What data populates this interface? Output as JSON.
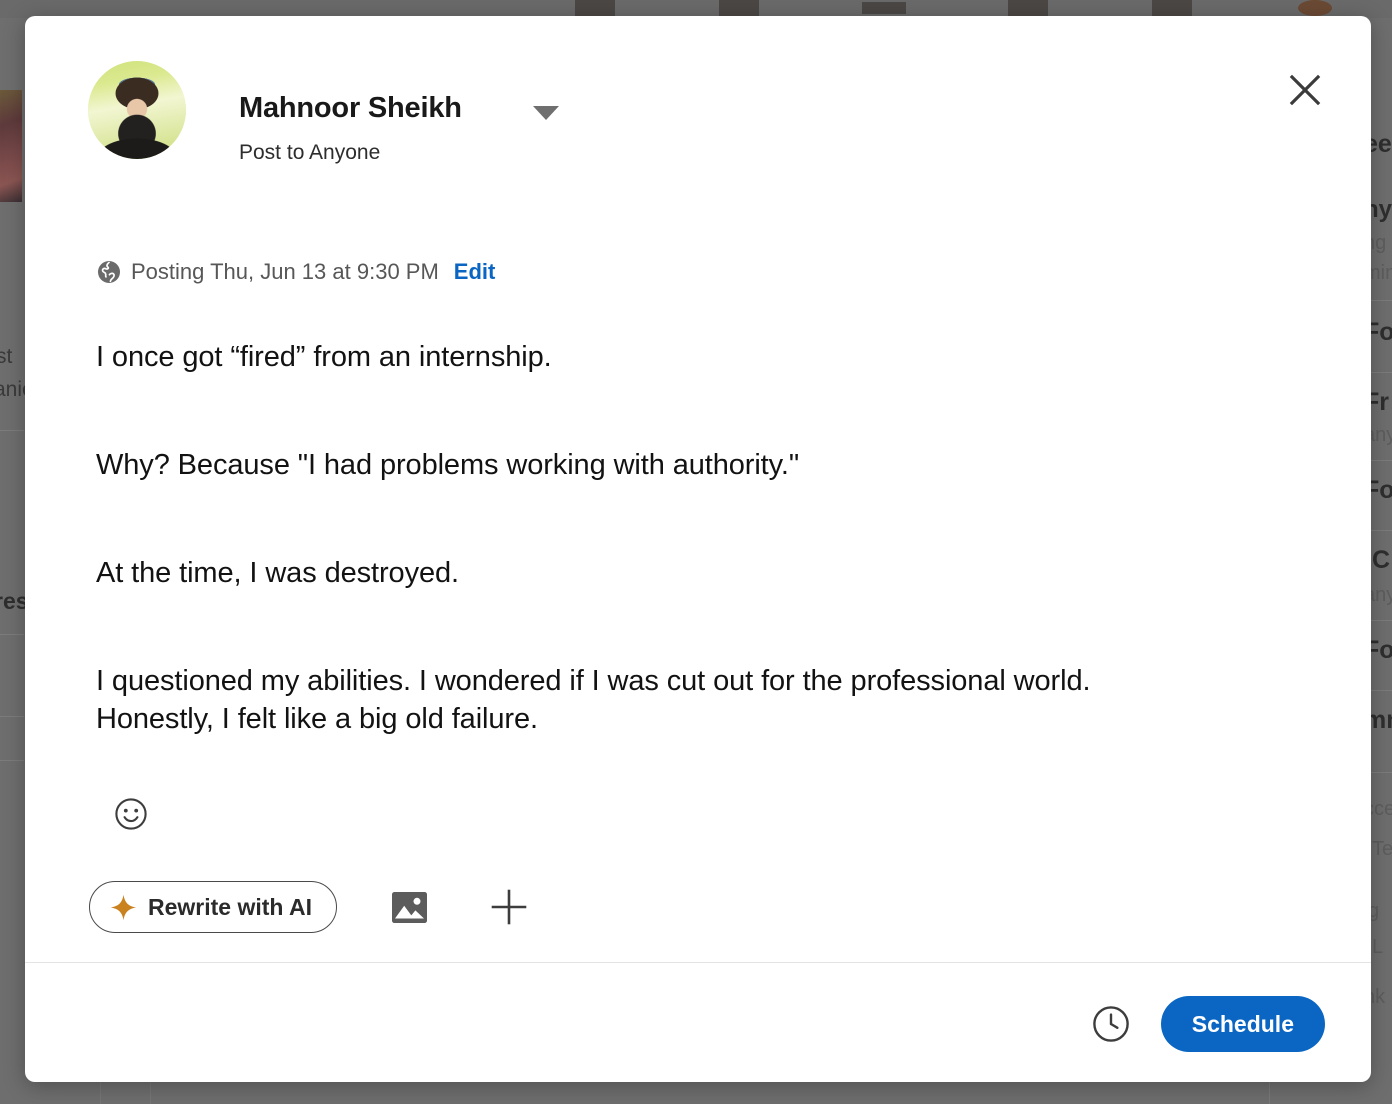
{
  "modal": {
    "author": {
      "name": "Mahnoor Sheikh",
      "subtitle": "Post to Anyone",
      "avatar_alt": "avatar"
    },
    "close_label": "Close",
    "schedule_status": {
      "visibility_icon": "globe-icon",
      "text": "Posting Thu, Jun 13 at 9:30 PM",
      "edit_label": "Edit"
    },
    "post": {
      "lines": [
        "I once got “fired” from an internship.",
        "Why? Because \"I had problems working with authority.\"",
        "At the time, I was destroyed.",
        "I questioned my abilities. I wondered if I was cut out for the professional world.",
        "Honestly, I felt like a big old failure."
      ]
    },
    "toolbar": {
      "emoji_icon": "emoji-smiley-icon",
      "ai_label": "Rewrite with AI",
      "ai_icon": "sparkle-icon",
      "image_icon": "image-icon",
      "add_icon": "plus-icon"
    },
    "footer": {
      "clock_icon": "clock-icon",
      "schedule_label": "Schedule"
    }
  },
  "colors": {
    "accent_blue": "#0a66c2",
    "sparkle_orange": "#c9821f",
    "text_primary": "#121212",
    "text_muted": "#575757",
    "overlay": "#6e6e6e"
  },
  "background": {
    "left_fragments": [
      {
        "text": "st",
        "bold": false
      },
      {
        "text": "anie",
        "bold": false
      },
      {
        "text": "res",
        "bold": true
      }
    ],
    "right_fragments": [
      {
        "text": "eed",
        "bold": true
      },
      {
        "text": "ny",
        "bold": true
      },
      {
        "text": "ng",
        "bold": false
      },
      {
        "text": "min",
        "bold": false
      },
      {
        "text": "Fo",
        "bold": true
      },
      {
        "text": "Fr",
        "bold": true
      },
      {
        "text": "any",
        "bold": false
      },
      {
        "text": "Fo",
        "bold": true
      },
      {
        "text": "C",
        "bold": true
      },
      {
        "text": "any",
        "bold": false
      },
      {
        "text": "Fo",
        "bold": true
      },
      {
        "text": "mm",
        "bold": true
      },
      {
        "text": "cce",
        "bold": false
      },
      {
        "text": "Te",
        "bold": false
      },
      {
        "text": "g",
        "bold": false
      },
      {
        "text": "L",
        "bold": false
      },
      {
        "text": "nk",
        "bold": false
      }
    ]
  }
}
